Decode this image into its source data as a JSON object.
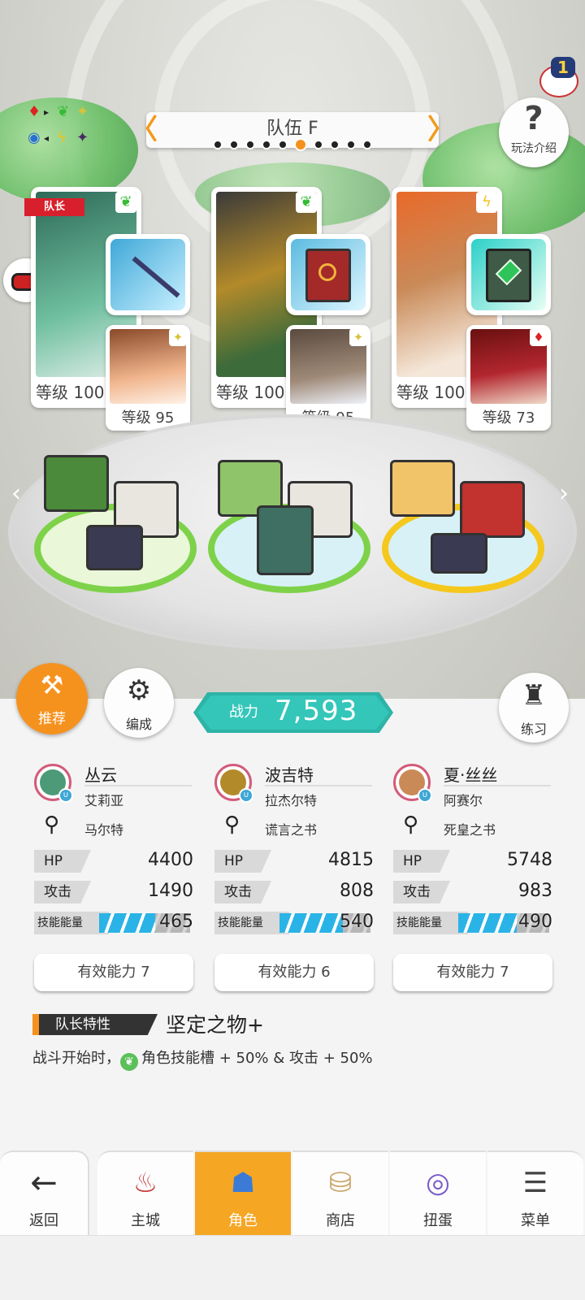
{
  "header": {
    "team_name": "队伍 F",
    "prev_symbol": "〈",
    "next_symbol": "〉",
    "page_count": 10,
    "active_page": 6,
    "help_label": "玩法介绍",
    "help_symbol": "?",
    "notification_count": "1"
  },
  "elements_legend": {
    "icons": [
      "diamond-red-icon",
      "leaf-green-icon",
      "sparkle-yellow-icon",
      "circle-blue-icon",
      "bolt-yellow-icon",
      "star-purple-icon"
    ]
  },
  "team": [
    {
      "leader_tag": "队长",
      "main_level": "等级 100",
      "main_element": "leaf",
      "sub_level": "等级 95",
      "sub_element": "sparkle",
      "equip_icon": "spear-icon",
      "colors": {
        "portrait": "#4c9a78",
        "equip": "#58c6e8",
        "sub": "#f0b48c"
      }
    },
    {
      "main_level": "等级 100",
      "main_element": "leaf",
      "sub_level": "等级 95",
      "sub_element": "sparkle",
      "equip_icon": "red-book-icon",
      "colors": {
        "portrait": "#b38a2a",
        "equip": "#a42a2a",
        "sub": "#9f8a78"
      }
    },
    {
      "main_level": "等级 100",
      "main_element": "bolt",
      "sub_level": "等级 73",
      "sub_element": "diamond",
      "equip_icon": "green-book-icon",
      "colors": {
        "portrait": "#c98a58",
        "equip": "#3f5a46",
        "sub": "#b2262e"
      }
    }
  ],
  "controls": {
    "recommend_label": "推荐",
    "formation_label": "编成",
    "practice_label": "练习",
    "power_label": "战力",
    "power_value": "7,593"
  },
  "stats": [
    {
      "name": "丛云",
      "sub_name": "艾莉亚",
      "weapon": "马尔特",
      "hp_label": "HP",
      "hp": "4400",
      "atk_label": "攻击",
      "atk": "1490",
      "energy_label": "技能能量",
      "energy": "465",
      "energy_fill": 0.62,
      "ability": "有效能力 7",
      "avatar_color": "#4c9a78"
    },
    {
      "name": "波吉特",
      "sub_name": "拉杰尔特",
      "weapon": "谎言之书",
      "hp_label": "HP",
      "hp": "4815",
      "atk_label": "攻击",
      "atk": "808",
      "energy_label": "技能能量",
      "energy": "540",
      "energy_fill": 0.7,
      "ability": "有效能力 6",
      "avatar_color": "#b38a2a"
    },
    {
      "name": "夏·丝丝",
      "sub_name": "阿赛尔",
      "weapon": "死皇之书",
      "hp_label": "HP",
      "hp": "5748",
      "atk_label": "攻击",
      "atk": "983",
      "energy_label": "技能能量",
      "energy": "490",
      "energy_fill": 0.64,
      "ability": "有效能力 7",
      "avatar_color": "#c98a58"
    }
  ],
  "leader_trait": {
    "title": "队长特性",
    "skill": "坚定之物+",
    "desc_prefix": "战斗开始时，",
    "desc_rest": "角色技能槽 + 50% & 攻击 + 50%"
  },
  "nav": {
    "back": "返回",
    "items": [
      {
        "label": "主城",
        "icon": "castle-icon"
      },
      {
        "label": "角色",
        "icon": "character-icon"
      },
      {
        "label": "商店",
        "icon": "shop-icon"
      },
      {
        "label": "扭蛋",
        "icon": "gacha-icon"
      },
      {
        "label": "菜单",
        "icon": "menu-icon"
      }
    ],
    "active_index": 1
  }
}
